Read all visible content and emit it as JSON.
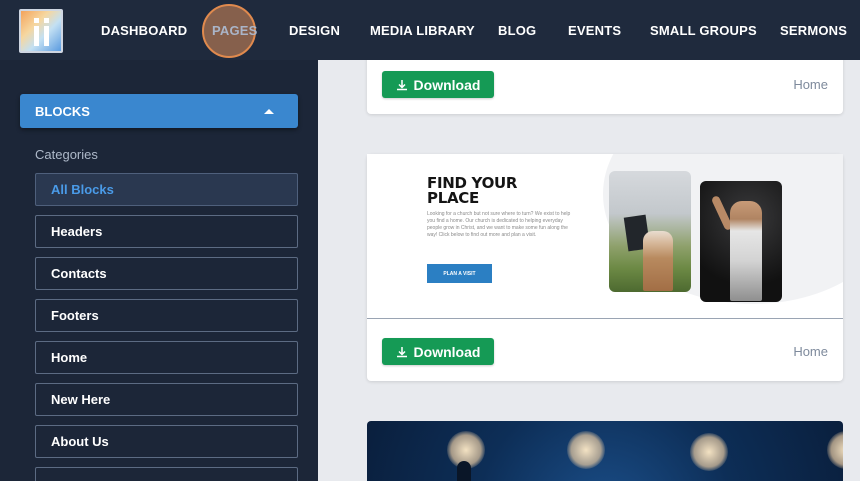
{
  "nav": {
    "items": [
      "DASHBOARD",
      "PAGES",
      "DESIGN",
      "MEDIA LIBRARY",
      "BLOG",
      "EVENTS",
      "SMALL GROUPS",
      "SERMONS"
    ],
    "active": "PAGES"
  },
  "sidebar": {
    "blocks_label": "BLOCKS",
    "categories_label": "Categories",
    "categories": [
      "All Blocks",
      "Headers",
      "Contacts",
      "Footers",
      "Home",
      "New Here",
      "About Us"
    ]
  },
  "cards": [
    {
      "download_label": "Download",
      "tag": "Home"
    },
    {
      "download_label": "Download",
      "tag": "Home",
      "preview": {
        "title_line1": "FIND YOUR",
        "title_line2": "PLACE",
        "body": "Looking for a church but not sure where to turn? We exist to help you find a home. Our church is dedicated to helping everyday people grow in Christ, and we want to make some fun along the way! Click below to find out more and plan a visit.",
        "button": "PLAN A VISIT"
      }
    }
  ],
  "colors": {
    "nav_bg": "#1f2a3d",
    "sidebar_bg": "#1c2638",
    "accent_blue": "#3a87cf",
    "download_green": "#159a55",
    "active_category_text": "#4a9be8"
  }
}
